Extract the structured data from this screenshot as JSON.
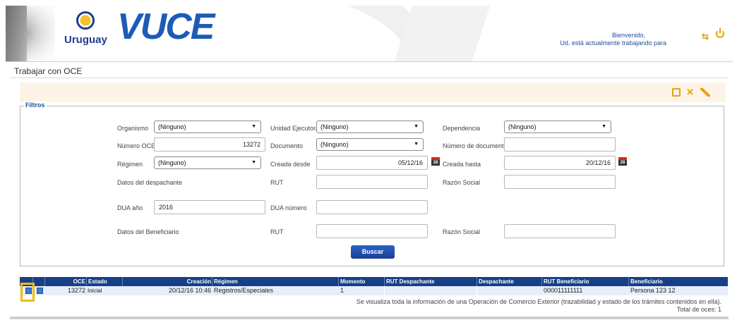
{
  "header": {
    "country": "Uruguay",
    "brand": "VUCE",
    "welcome_line1": "Bienvenido,",
    "welcome_line2": "Ud. está actualmente trabajando para"
  },
  "page": {
    "title": "Trabajar con OCE"
  },
  "toolbar": {
    "icons": [
      "print-icon",
      "close-icon",
      "broom-icon"
    ]
  },
  "filters": {
    "legend": "Filtros",
    "organismo": {
      "label": "Organismo",
      "value": "(Ninguno)"
    },
    "unidad_ejecutora": {
      "label": "Unidad Ejecutora",
      "value": "(Ninguno)"
    },
    "dependencia": {
      "label": "Dependencia",
      "value": "(Ninguno)"
    },
    "numero_oce": {
      "label": "Número OCE",
      "value": "13272"
    },
    "documento": {
      "label": "Documento",
      "value": "(Ninguno)"
    },
    "numero_documento": {
      "label": "Número de documento",
      "value": ""
    },
    "regimen": {
      "label": "Régimen",
      "value": "(Ninguno)"
    },
    "creada_desde": {
      "label": "Creada desde",
      "value": "05/12/16"
    },
    "creada_hasta": {
      "label": "Creada hasta",
      "value": "20/12/16"
    },
    "datos_despachante": {
      "label": "Datos del despachante"
    },
    "rut_despachante": {
      "label": "RUT",
      "value": ""
    },
    "razon_social_despachante": {
      "label": "Razón Social",
      "value": ""
    },
    "dua_anio": {
      "label": "DUA año",
      "value": "2016"
    },
    "dua_numero": {
      "label": "DUA número",
      "value": ""
    },
    "datos_beneficiario": {
      "label": "Datos del Beneficiario"
    },
    "rut_beneficiario": {
      "label": "RUT",
      "value": ""
    },
    "razon_social_beneficiario": {
      "label": "Razón Social",
      "value": ""
    },
    "calendar_day": "28",
    "search_button": "Buscar"
  },
  "table": {
    "columns": [
      "OCE",
      "Estado",
      "Creación",
      "Régimen",
      "Momento",
      "RUT Despachante",
      "Despachante",
      "RUT Beneficiario",
      "Beneficiario"
    ],
    "rows": [
      {
        "oce": "13272",
        "estado": "Inicial",
        "creacion": "20/12/16 10:46",
        "regimen": "Registros/Especiales",
        "momento": "1",
        "rut_despachante": "",
        "despachante": "",
        "rut_beneficiario": "000011111111",
        "beneficiario": "Persona 123 12"
      }
    ],
    "footer_note": "Se visualiza toda la información de una Operación de Comercio Exterior (trazabilidad y estado de los trámites contenidos en ella).",
    "total_label": "Total de oces:",
    "total_value": "1"
  },
  "colors": {
    "accent": "#e8a100",
    "header_blue": "#173f87",
    "brand_blue": "#1d5bb8"
  }
}
